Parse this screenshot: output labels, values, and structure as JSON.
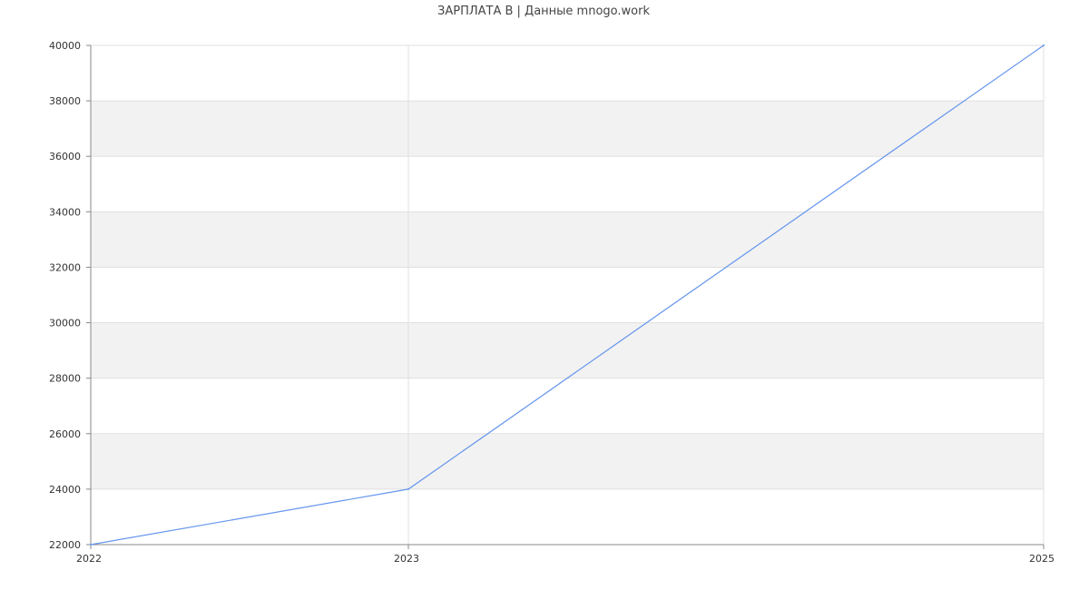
{
  "chart_data": {
    "type": "line",
    "title": "ЗАРПЛАТА В  | Данные mnogo.work",
    "xlabel": "",
    "ylabel": "",
    "x": [
      2022,
      2023,
      2025
    ],
    "x_tick_labels": [
      "2022",
      "2023",
      "2025"
    ],
    "series": [
      {
        "values": [
          22000,
          24000,
          40000
        ],
        "color": "#6495ed"
      }
    ],
    "ylim": [
      22000,
      40000
    ],
    "y_ticks": [
      22000,
      24000,
      26000,
      28000,
      30000,
      32000,
      34000,
      36000,
      38000,
      40000
    ],
    "y_tick_labels": [
      "22000",
      "24000",
      "26000",
      "28000",
      "30000",
      "32000",
      "34000",
      "36000",
      "38000",
      "40000"
    ],
    "grid": true,
    "band_color": "#f2f2f2",
    "grid_color": "#e0e0e0",
    "axis_color": "#888888"
  }
}
